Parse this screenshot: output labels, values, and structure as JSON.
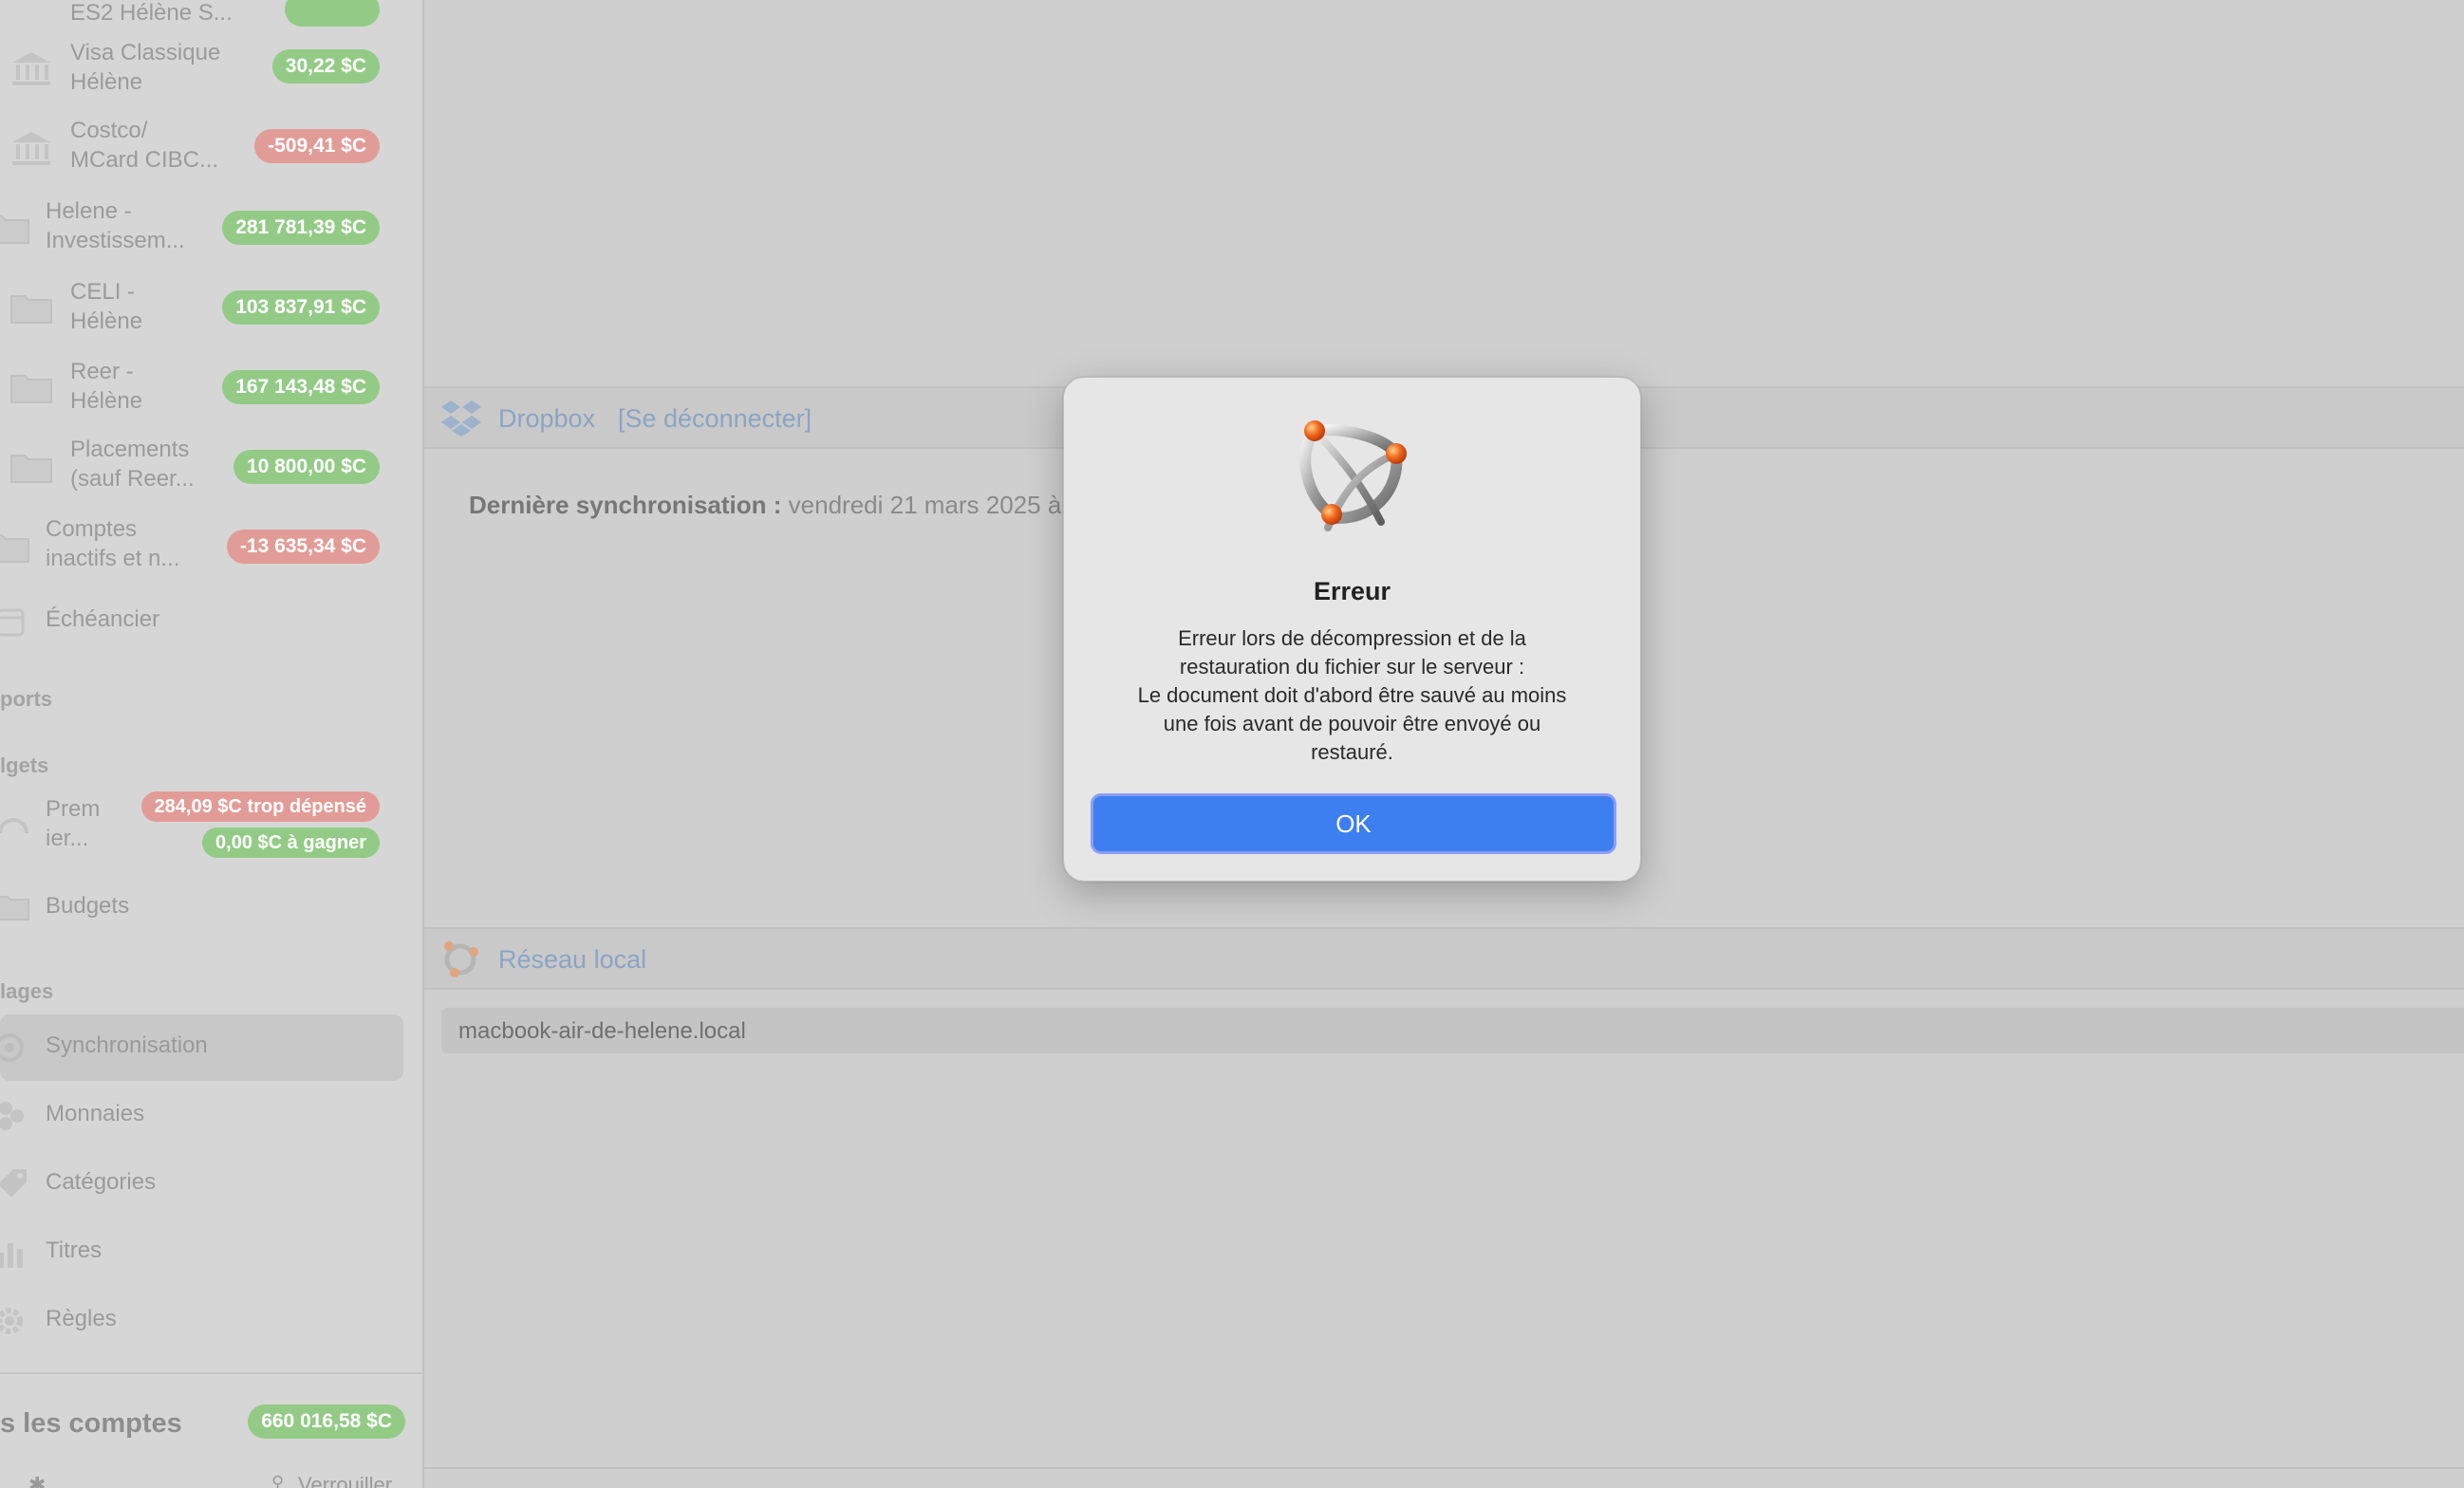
{
  "sidebar": {
    "accounts": [
      {
        "name": "ES2 Hélène S...",
        "balance": "",
        "sign": "pos",
        "icon": "bank-icon"
      },
      {
        "name_line1": "Visa Classique",
        "name_line2": "Hélène",
        "balance": "30,22 $C",
        "sign": "pos",
        "icon": "bank-icon"
      },
      {
        "name_line1": "Costco/",
        "name_line2": "MCard CIBC...",
        "balance": "-509,41 $C",
        "sign": "neg",
        "icon": "bank-icon"
      },
      {
        "name_line1": "Helene -",
        "name_line2": "Investissem...",
        "balance": "281 781,39 $C",
        "sign": "pos",
        "icon": "folder-icon"
      },
      {
        "name_line1": "CELI -",
        "name_line2": "Hélène",
        "balance": "103 837,91 $C",
        "sign": "pos",
        "icon": "folder-icon"
      },
      {
        "name_line1": "Reer -",
        "name_line2": "Hélène",
        "balance": "167 143,48 $C",
        "sign": "pos",
        "icon": "folder-icon"
      },
      {
        "name_line1": "Placements",
        "name_line2": "(sauf Reer...",
        "balance": "10 800,00 $C",
        "sign": "pos",
        "icon": "folder-icon"
      },
      {
        "name_line1": "Comptes",
        "name_line2": "inactifs et n...",
        "balance": "-13 635,34 $C",
        "sign": "neg",
        "icon": "folder-icon"
      }
    ],
    "scheduler_label": "Échéancier",
    "reports_section": "ports",
    "budgets_section": "lgets",
    "budget_item": {
      "name_line1": "Prem",
      "name_line2": "ier...",
      "overspent": "284,09 $C trop dépensé",
      "to_earn": "0,00 $C à gagner"
    },
    "budgets_label": "Budgets",
    "settings_section": "lages",
    "settings_items": [
      {
        "label": "Synchronisation",
        "icon": "sync-icon",
        "selected": true
      },
      {
        "label": "Monnaies",
        "icon": "currency-icon",
        "selected": false
      },
      {
        "label": "Catégories",
        "icon": "tag-icon",
        "selected": false
      },
      {
        "label": "Titres",
        "icon": "chart-icon",
        "selected": false
      },
      {
        "label": "Règles",
        "icon": "gear-icon",
        "selected": false
      }
    ],
    "all_accounts_label": "s les comptes",
    "all_accounts_total": "660 016,58 $C",
    "footer_right": "Verrouiller"
  },
  "main": {
    "dropbox": {
      "title": "Dropbox",
      "disconnect": "[Se déconnecter]",
      "last_sync_label": "Dernière synchronisation :",
      "last_sync_value": "vendredi 21 mars 2025 à"
    },
    "local_network": {
      "title": "Réseau local",
      "host": "macbook-air-de-helene.local"
    }
  },
  "dialog": {
    "title": "Erreur",
    "message_lines": [
      "Erreur lors de décompression et de la",
      "restauration du fichier sur le serveur :",
      "Le document doit d'abord être sauvé au moins",
      "une fois avant de pouvoir être envoyé ou",
      "restauré."
    ],
    "ok_label": "OK"
  },
  "colors": {
    "accent": "#3d7ff0",
    "positive": "#93cb86",
    "negative": "#e29c97",
    "link": "#8ba4c4"
  }
}
